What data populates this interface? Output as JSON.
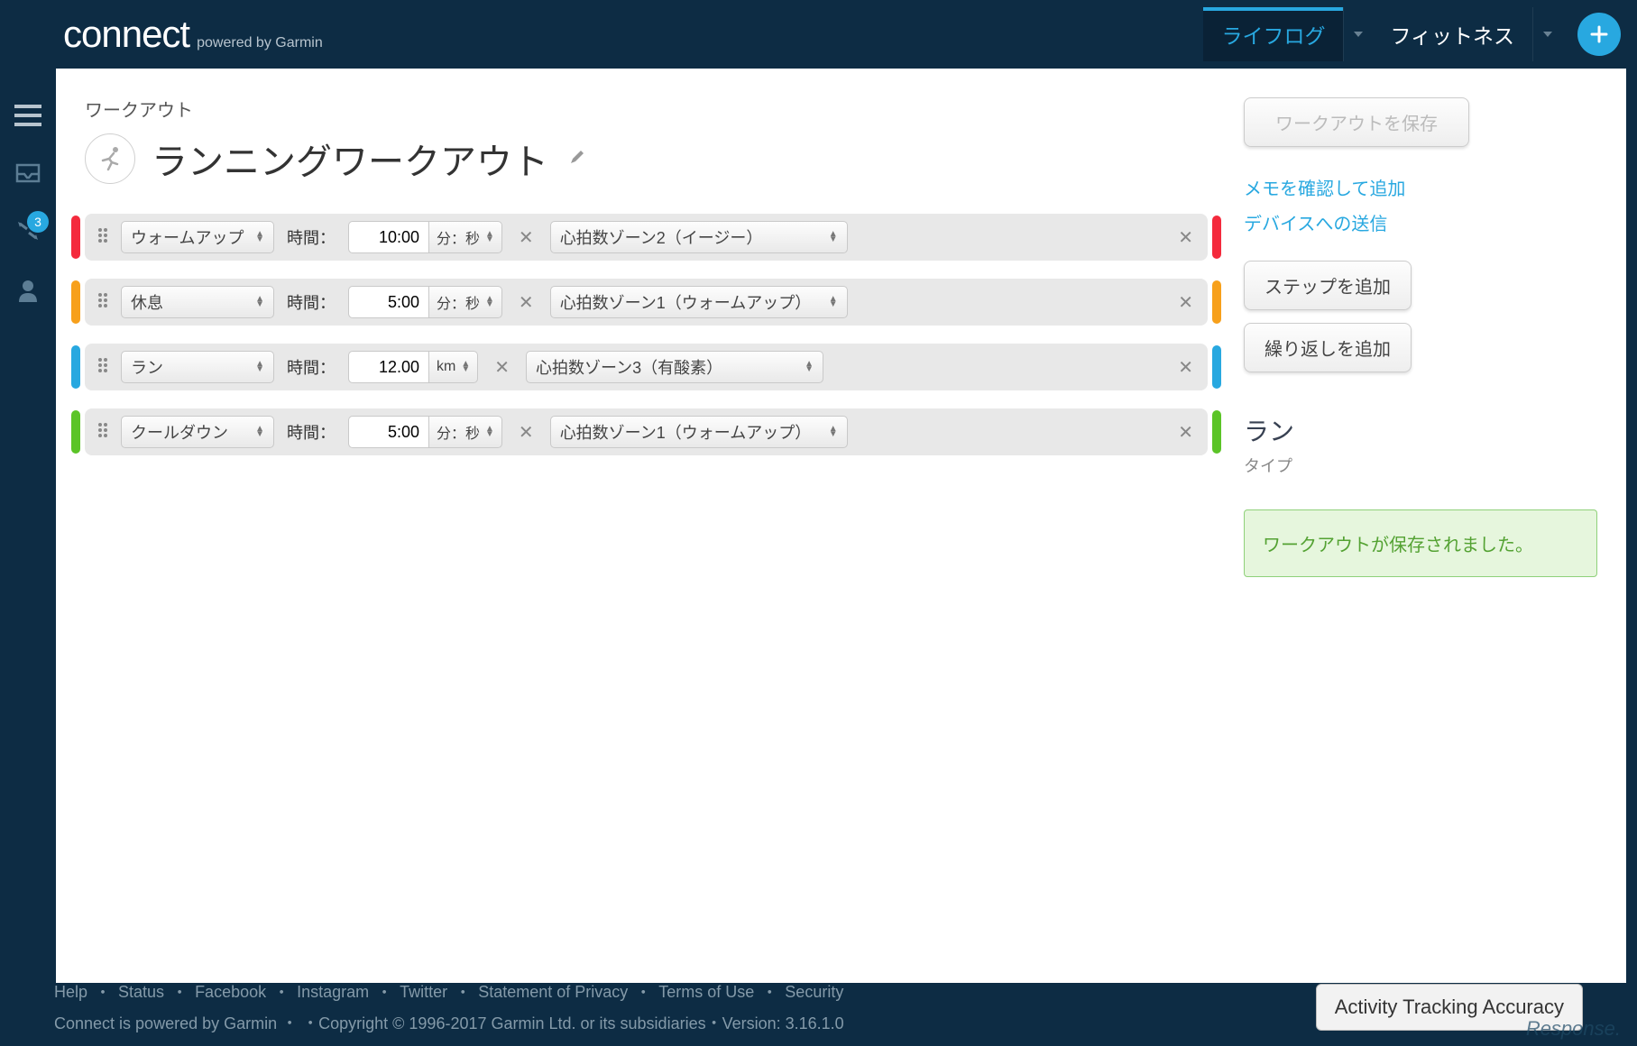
{
  "header": {
    "logo": "connect",
    "logo_sub": "powered by Garmin",
    "tabs": [
      {
        "label": "ライフログ",
        "active": true
      },
      {
        "label": "フィットネス",
        "active": false
      }
    ],
    "add_label": "+"
  },
  "rail": {
    "badge_count": "3"
  },
  "breadcrumb": "ワークアウト",
  "title": "ランニングワークアウト",
  "time_label": "時間：",
  "steps": [
    {
      "color": "#f42a3d",
      "type": "ウォームアップ",
      "value": "10:00",
      "unit": "分：秒",
      "zone": "心拍数ゾーン2（イージー）"
    },
    {
      "color": "#f7a01b",
      "type": "休息",
      "value": "5:00",
      "unit": "分：秒",
      "zone": "心拍数ゾーン1（ウォームアップ）"
    },
    {
      "color": "#28a8e0",
      "type": "ラン",
      "value": "12.00",
      "unit": "km",
      "zone": "心拍数ゾーン3（有酸素）"
    },
    {
      "color": "#5bc427",
      "type": "クールダウン",
      "value": "5:00",
      "unit": "分：秒",
      "zone": "心拍数ゾーン1（ウォームアップ）"
    }
  ],
  "sidebar": {
    "save_btn": "ワークアウトを保存",
    "link_note": "メモを確認して追加",
    "link_send": "デバイスへの送信",
    "add_step": "ステップを追加",
    "add_repeat": "繰り返しを追加",
    "section_title": "ラン",
    "section_sub": "タイプ",
    "success": "ワークアウトが保存されました。"
  },
  "footer": {
    "links": [
      "Help",
      "Status",
      "Facebook",
      "Instagram",
      "Twitter",
      "Statement of Privacy",
      "Terms of Use",
      "Security"
    ],
    "copyright": "Connect is powered by Garmin ・ ・Copyright © 1996-2017 Garmin Ltd. or its subsidiaries・Version: 3.16.1.0",
    "accuracy_btn": "Activity Tracking Accuracy"
  },
  "watermark": "Response."
}
